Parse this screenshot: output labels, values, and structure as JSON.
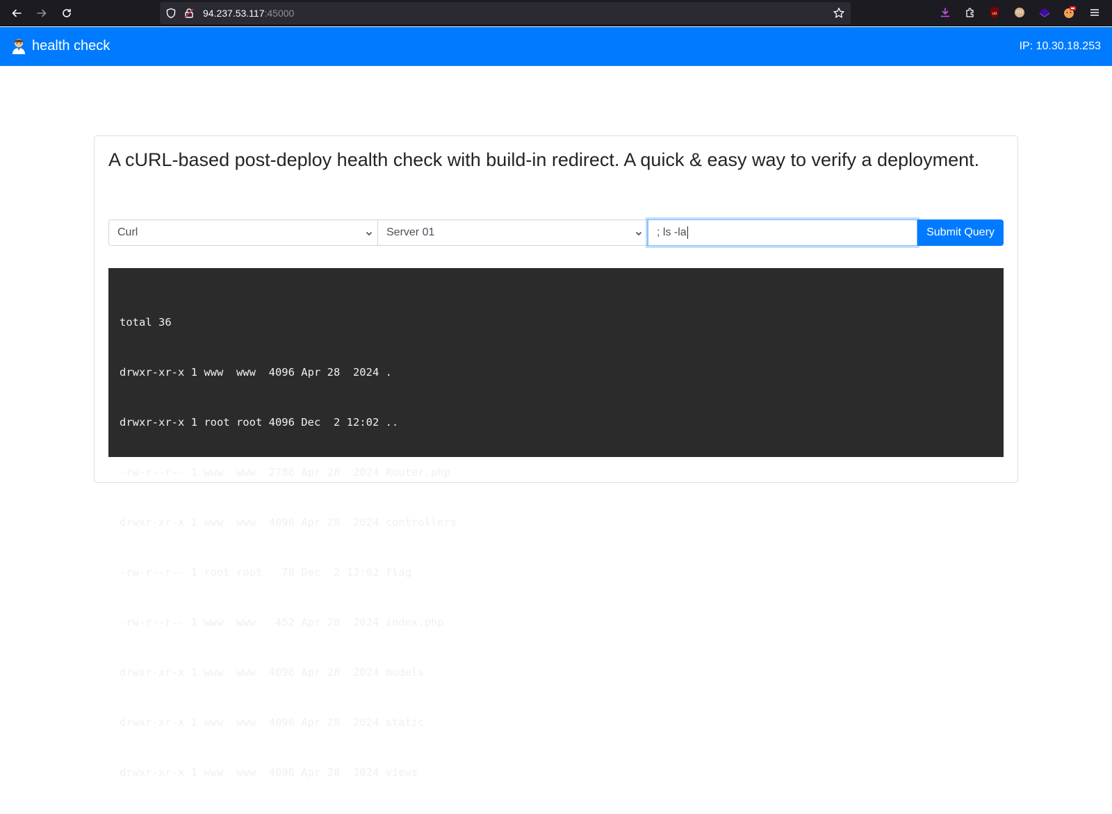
{
  "browser": {
    "url_host": "94.237.53.117",
    "url_port": ":45000"
  },
  "navbar": {
    "brand_emoji": "👨‍⚕️",
    "brand_label": "health check",
    "ip_text": "IP: 10.30.18.253"
  },
  "card": {
    "lead": "A cURL-based post-deploy health check with build-in redirect. A quick & easy way to verify a deployment.",
    "tool_select": "Curl",
    "server_select": "Server 01",
    "command_input": "; ls -la",
    "submit_label": "Submit Query"
  },
  "output": {
    "lines": [
      "total 36",
      "drwxr-xr-x 1 www  www  4096 Apr 28  2024 .",
      "drwxr-xr-x 1 root root 4096 Dec  2 12:02 ..",
      "-rw-r--r-- 1 www  www  2786 Apr 28  2024 Router.php",
      "drwxr-xr-x 1 www  www  4096 Apr 28  2024 controllers",
      "-rw-r--r-- 1 root root   78 Dec  2 12:02 flag",
      "-rw-r--r-- 1 www  www   452 Apr 28  2024 index.php",
      "drwxr-xr-x 1 www  www  4096 Apr 28  2024 models",
      "drwxr-xr-x 1 www  www  4096 Apr 28  2024 static",
      "drwxr-xr-x 1 www  www  4096 Apr 28  2024 views"
    ]
  },
  "colors": {
    "navbar": "#007bff",
    "output_bg": "#2b2b2b",
    "chrome_bg": "#1c1b22"
  },
  "icons": [
    "back-arrow-icon",
    "forward-arrow-icon",
    "reload-icon",
    "shield-icon",
    "lock-icon",
    "bookmark-star-icon",
    "downloads-icon",
    "extensions-icon",
    "ublock-icon",
    "privacy-badger-icon",
    "wappalyzer-icon",
    "foxyproxy-icon",
    "menu-icon"
  ]
}
